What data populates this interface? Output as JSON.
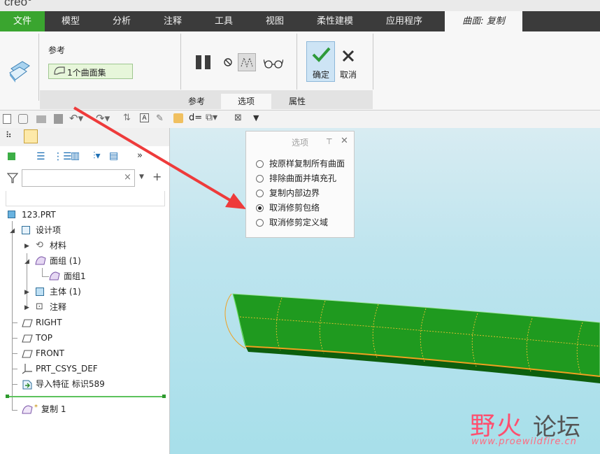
{
  "app": {
    "logo_text": "creo°"
  },
  "menubar": {
    "items": [
      "文件",
      "模型",
      "分析",
      "注释",
      "工具",
      "视图",
      "柔性建模",
      "应用程序"
    ],
    "context_tab": "曲面: 复制"
  },
  "ribbon": {
    "reference_label": "参考",
    "reference_value": "1个曲面集",
    "confirm_label": "确定",
    "cancel_label": "取消",
    "sub_tabs": [
      "参考",
      "选项",
      "属性"
    ],
    "active_sub_tab": "选项"
  },
  "options_popup": {
    "title": "选项",
    "options": [
      {
        "label": "按原样复制所有曲面",
        "selected": false
      },
      {
        "label": "排除曲面并填充孔",
        "selected": false
      },
      {
        "label": "复制内部边界",
        "selected": false
      },
      {
        "label": "取消修剪包络",
        "selected": true
      },
      {
        "label": "取消修剪定义域",
        "selected": false
      }
    ]
  },
  "model_tree": {
    "filter_placeholder": "",
    "root": "123.PRT",
    "design_items": "设计项",
    "material": "材料",
    "quilt_group": "面组 (1)",
    "quilt_item": "面组1",
    "body_group": "主体 (1)",
    "annotations": "注释",
    "datum_right": "RIGHT",
    "datum_top": "TOP",
    "datum_front": "FRONT",
    "csys": "PRT_CSYS_DEF",
    "import_feature": "导入特征 标识589",
    "copy_feature": "复制 1",
    "new_marker": "*"
  },
  "watermark": {
    "name_colored": "野火",
    "name_plain": "论坛",
    "url": "www.proewildfire.cn"
  },
  "colors": {
    "accent_green": "#3aa52f",
    "menubar_bg": "#3b3b3b",
    "model_green": "#1f9a1f",
    "edge_orange": "#f0a020",
    "annotation_arrow": "#ee3b3b"
  }
}
